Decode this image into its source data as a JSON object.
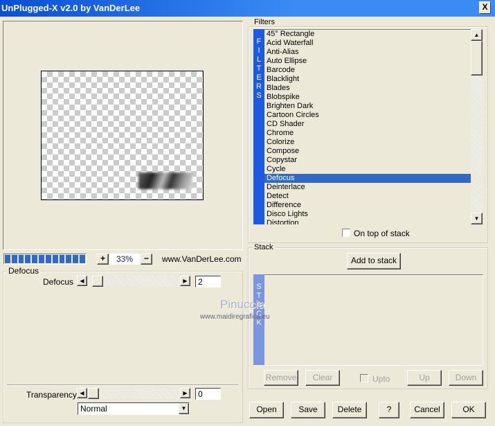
{
  "window": {
    "title": "UnPlugged-X v2.0 by VanDerLee",
    "close": "X"
  },
  "preview": {
    "zoom": "33%",
    "plus": "+",
    "minus": "−",
    "website": "www.VanDerLee.com",
    "progress_blocks": 12
  },
  "defocus_group": {
    "title": "Defocus",
    "param_label": "Defocus",
    "value": "2"
  },
  "transparency": {
    "label": "Transparency",
    "value": "0",
    "blend_mode": "Normal"
  },
  "filters": {
    "title": "Filters",
    "strip": "FILTERS",
    "items": [
      "45° Rectangle",
      "Acid Waterfall",
      "Anti-Alias",
      "Auto Ellipse",
      "Barcode",
      "Blacklight",
      "Blades",
      "Blobspike",
      "Brighten Dark",
      "Cartoon Circles",
      "CD Shader",
      "Chrome",
      "Colorize",
      "Compose",
      "Copystar",
      "Cycle",
      "Defocus",
      "Deinterlace",
      "Detect",
      "Difference",
      "Disco Lights",
      "Distortion"
    ],
    "selected": "Defocus",
    "on_top_label": "On top of stack"
  },
  "stack": {
    "title": "Stack",
    "strip": "STACK",
    "add": "Add to stack",
    "remove": "Remove",
    "clear": "Clear",
    "upto": "Upto",
    "up": "Up",
    "down": "Down"
  },
  "buttons": {
    "open": "Open",
    "save": "Save",
    "delete": "Delete",
    "help": "?",
    "cancel": "Cancel",
    "ok": "OK"
  },
  "watermark": {
    "name": "Pinuccia",
    "url": "www.maidiregrafica.eu"
  },
  "colors": {
    "title_bar": "#0a4fd4",
    "selection": "#316ac5",
    "filters_strip": "#1c5ae0",
    "stack_strip": "#7b96e0"
  }
}
